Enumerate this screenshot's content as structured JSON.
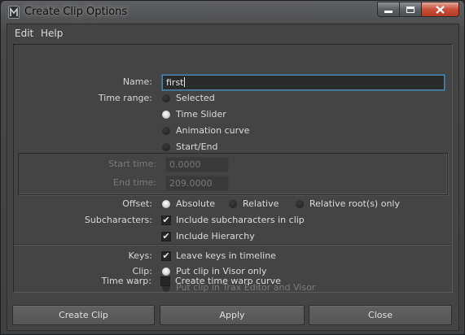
{
  "window": {
    "title": "Create Clip Options"
  },
  "menubar": {
    "items": [
      "Edit",
      "Help"
    ]
  },
  "form": {
    "name_label": "Name:",
    "name_value": "first",
    "time_range_label": "Time range:",
    "time_range_options": [
      "Selected",
      "Time Slider",
      "Animation curve",
      "Start/End"
    ],
    "time_range_selected": "Time Slider",
    "start_time_label": "Start time:",
    "start_time_value": "0.0000",
    "end_time_label": "End time:",
    "end_time_value": "209.0000",
    "offset_label": "Offset:",
    "offset_options": [
      "Absolute",
      "Relative",
      "Relative root(s) only"
    ],
    "offset_selected": "Absolute",
    "subcharacters_label": "Subcharacters:",
    "include_subcharacters_label": "Include subcharacters in clip",
    "include_subcharacters_checked": true,
    "include_hierarchy_label": "Include Hierarchy",
    "include_hierarchy_checked": true,
    "keys_label": "Keys:",
    "leave_keys_label": "Leave keys in timeline",
    "leave_keys_checked": true,
    "clip_label": "Clip:",
    "clip_options": [
      "Put clip in Visor only",
      "Put clip in Trax Editor and Visor"
    ],
    "clip_selected": "Put clip in Visor only",
    "time_warp_label": "Time warp:",
    "time_warp_option": "Create time warp curve",
    "time_warp_checked": false
  },
  "buttons": {
    "create": "Create Clip",
    "apply": "Apply",
    "close": "Close"
  },
  "colors": {
    "accent_focus": "#5285a6",
    "panel_bg": "#444444",
    "close_button": "#c8503a"
  }
}
